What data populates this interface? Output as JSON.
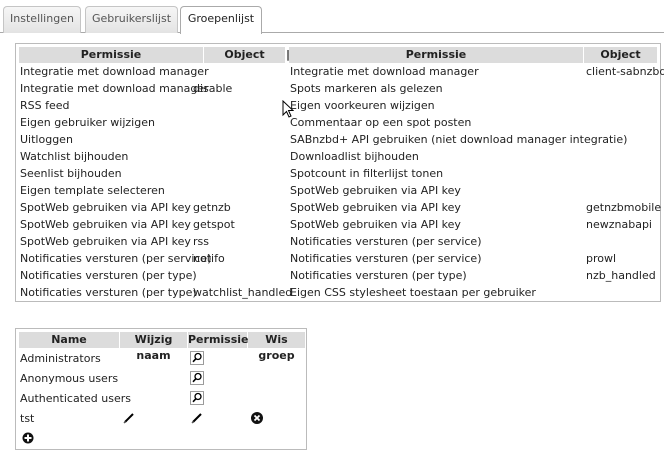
{
  "tabs": [
    {
      "label": "Instellingen"
    },
    {
      "label": "Gebruikerslijst"
    },
    {
      "label": "Groepenlijst"
    }
  ],
  "permissions_table": {
    "headers": {
      "perm": "Permissie",
      "obj": "Object",
      "sep": "|"
    },
    "left": [
      {
        "perm": "Integratie met download manager",
        "obj": ""
      },
      {
        "perm": "Integratie met download manager",
        "obj": "disable"
      },
      {
        "perm": "RSS feed",
        "obj": ""
      },
      {
        "perm": "Eigen gebruiker wijzigen",
        "obj": ""
      },
      {
        "perm": "Uitloggen",
        "obj": ""
      },
      {
        "perm": "Watchlist bijhouden",
        "obj": ""
      },
      {
        "perm": "Seenlist bijhouden",
        "obj": ""
      },
      {
        "perm": "Eigen template selecteren",
        "obj": ""
      },
      {
        "perm": "SpotWeb gebruiken via API key",
        "obj": "getnzb"
      },
      {
        "perm": "SpotWeb gebruiken via API key",
        "obj": "getspot"
      },
      {
        "perm": "SpotWeb gebruiken via API key",
        "obj": "rss"
      },
      {
        "perm": "Notificaties versturen (per service)",
        "obj": "notifo"
      },
      {
        "perm": "Notificaties versturen (per type)",
        "obj": ""
      },
      {
        "perm": "Notificaties versturen (per type)",
        "obj": "watchlist_handled"
      }
    ],
    "right": [
      {
        "perm": "Integratie met download manager",
        "obj": "client-sabnzbd"
      },
      {
        "perm": "Spots markeren als gelezen",
        "obj": ""
      },
      {
        "perm": "Eigen voorkeuren wijzigen",
        "obj": ""
      },
      {
        "perm": "Commentaar op een spot posten",
        "obj": ""
      },
      {
        "perm": "SABnzbd+ API gebruiken (niet download manager integratie)",
        "obj": ""
      },
      {
        "perm": "Downloadlist bijhouden",
        "obj": ""
      },
      {
        "perm": "Spotcount in filterlijst tonen",
        "obj": ""
      },
      {
        "perm": "SpotWeb gebruiken via API key",
        "obj": ""
      },
      {
        "perm": "SpotWeb gebruiken via API key",
        "obj": "getnzbmobile"
      },
      {
        "perm": "SpotWeb gebruiken via API key",
        "obj": "newznabapi"
      },
      {
        "perm": "Notificaties versturen (per service)",
        "obj": ""
      },
      {
        "perm": "Notificaties versturen (per service)",
        "obj": "prowl"
      },
      {
        "perm": "Notificaties versturen (per type)",
        "obj": "nzb_handled"
      },
      {
        "perm": "Eigen CSS stylesheet toestaan per gebruiker",
        "obj": ""
      }
    ]
  },
  "groups_table": {
    "headers": {
      "name": "Name",
      "rename": "Wijzig naam",
      "perms": "Permissies",
      "delete": "Wis groep"
    },
    "rows": [
      {
        "name": "Administrators",
        "rename_icon": "",
        "perms_icon": "magnifier-icon",
        "delete_icon": ""
      },
      {
        "name": "Anonymous users",
        "rename_icon": "",
        "perms_icon": "magnifier-icon",
        "delete_icon": ""
      },
      {
        "name": "Authenticated users",
        "rename_icon": "",
        "perms_icon": "magnifier-icon",
        "delete_icon": ""
      },
      {
        "name": "tst",
        "rename_icon": "pencil-icon",
        "perms_icon": "pencil-icon",
        "delete_icon": "delete-icon"
      }
    ],
    "add_icon": "add-icon"
  }
}
